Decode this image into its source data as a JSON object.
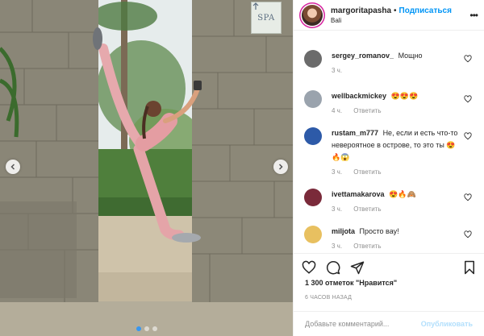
{
  "post": {
    "location_sign": "SPA",
    "carousel": {
      "slides": 3,
      "active": 1
    }
  },
  "header": {
    "username": "margoritapasha",
    "separator": "•",
    "follow_label": "Подписаться",
    "location": "Bali",
    "more_icon": "more-horizontal-icon"
  },
  "comments": [
    {
      "user": "sergey_romanov_",
      "text": "Мощно",
      "time": "3 ч.",
      "reply": "",
      "avatar_color": "#6b6b6b"
    },
    {
      "user": "wellbackmickey",
      "text": "😍😍😍",
      "time": "4 ч.",
      "reply": "Ответить",
      "avatar_color": "#9aa3ad"
    },
    {
      "user": "rustam_m777",
      "text": "Не, если и есть что-то невероятное в острове, то это ты 😍🔥😱",
      "time": "3 ч.",
      "reply": "Ответить",
      "avatar_color": "#2d5aa8"
    },
    {
      "user": "ivettamakarova",
      "text": "😍🔥🙈",
      "time": "3 ч.",
      "reply": "Ответить",
      "avatar_color": "#7a2a3a"
    },
    {
      "user": "miljota",
      "text": "Просто вау!",
      "time": "3 ч.",
      "reply": "Ответить",
      "avatar_color": "#e8c060"
    }
  ],
  "actions": {
    "like_icon": "heart-icon",
    "comment_icon": "comment-icon",
    "share_icon": "share-icon",
    "save_icon": "bookmark-icon"
  },
  "likes": "1 300 отметок \"Нравится\"",
  "time_ago": "6 ЧАСОВ НАЗАД",
  "add_comment": {
    "placeholder": "Добавьте комментарий...",
    "publish_label": "Опубликовать"
  },
  "colors": {
    "accent": "#0095f6",
    "publish_disabled": "#b2dffc",
    "muted": "#8e8e8e",
    "carousel_active": "#3897f0"
  }
}
